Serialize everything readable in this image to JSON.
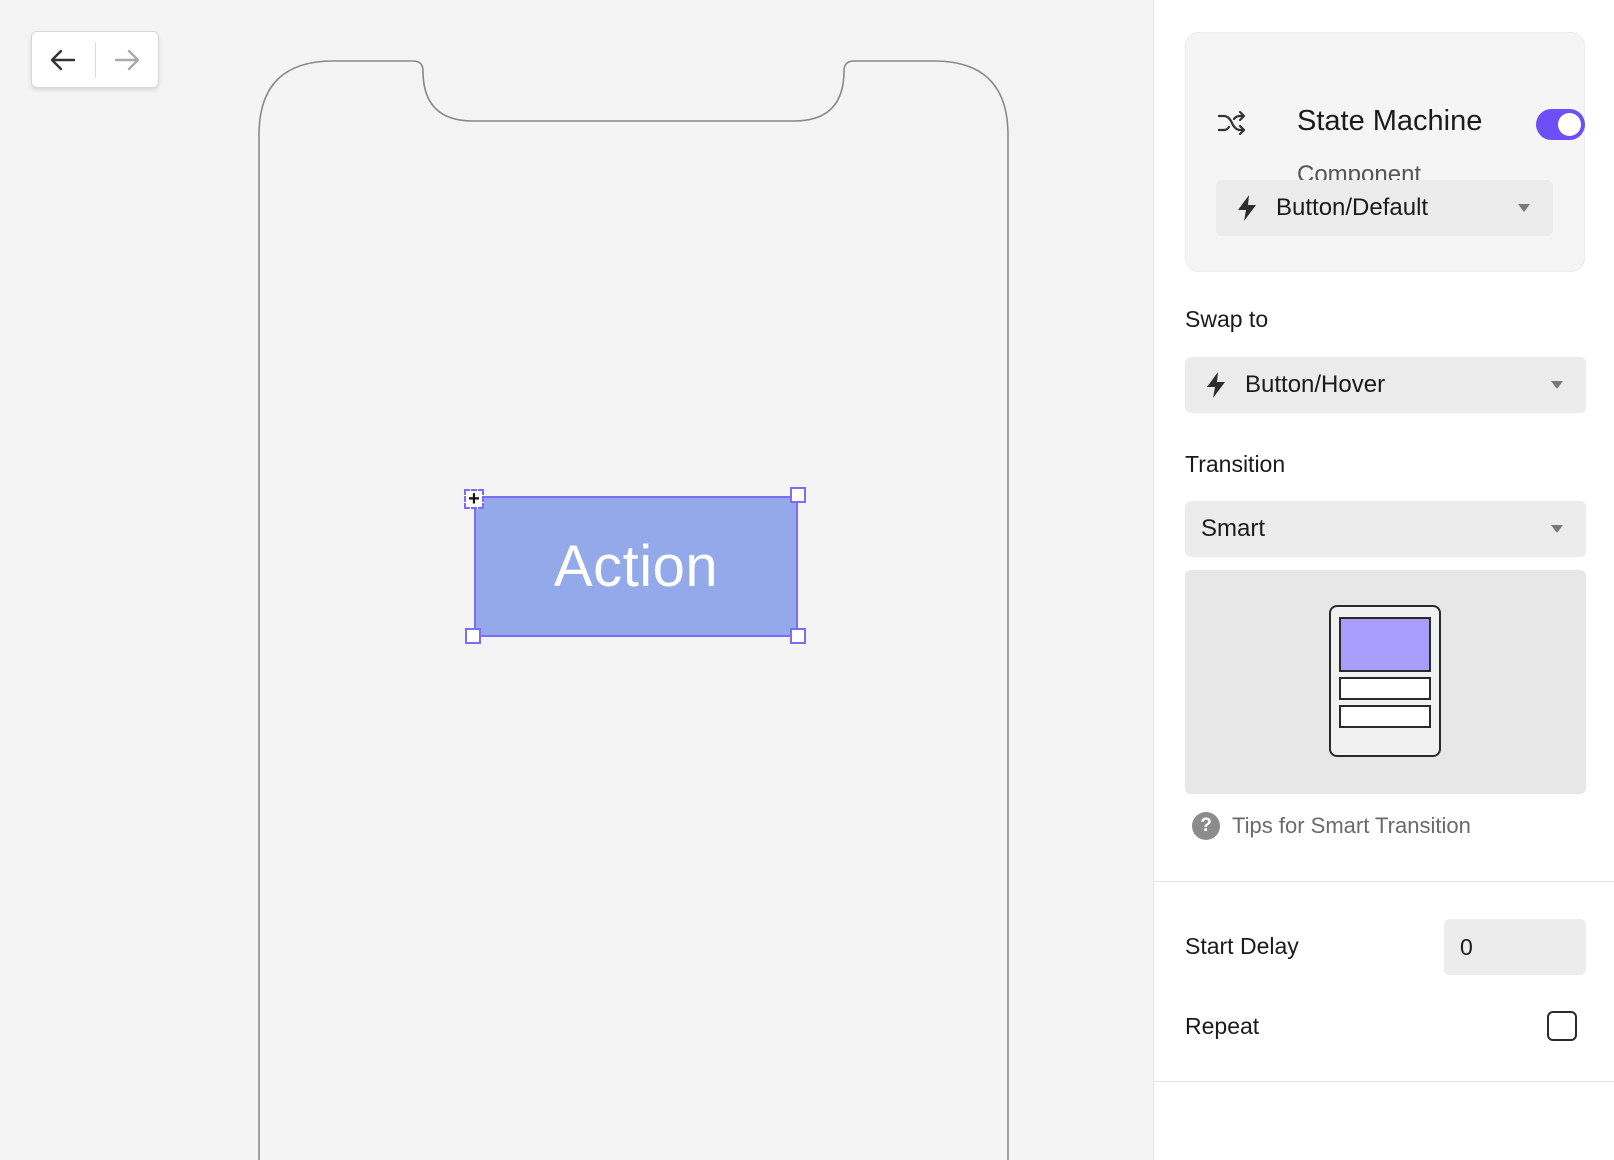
{
  "canvas": {
    "history": {
      "back_icon": "arrow-left-icon",
      "forward_icon": "arrow-right-icon"
    },
    "component": {
      "label": "Action"
    }
  },
  "panel": {
    "state_machine": {
      "icon": "shuffle-icon",
      "title": "State Machine",
      "enabled": true,
      "subtitle": "Component",
      "component_value": "Button/Default"
    },
    "swap_to": {
      "label": "Swap to",
      "value": "Button/Hover"
    },
    "transition": {
      "label": "Transition",
      "value": "Smart"
    },
    "tips": {
      "text": "Tips for Smart Transition"
    },
    "start_delay": {
      "label": "Start Delay",
      "value": "0"
    },
    "repeat": {
      "label": "Repeat",
      "checked": false
    }
  },
  "colors": {
    "accent": "#6c4ff6",
    "selection": "#7d6cf5",
    "button_fill": "#94a9e9",
    "preview_highlight": "#a99cfb"
  }
}
